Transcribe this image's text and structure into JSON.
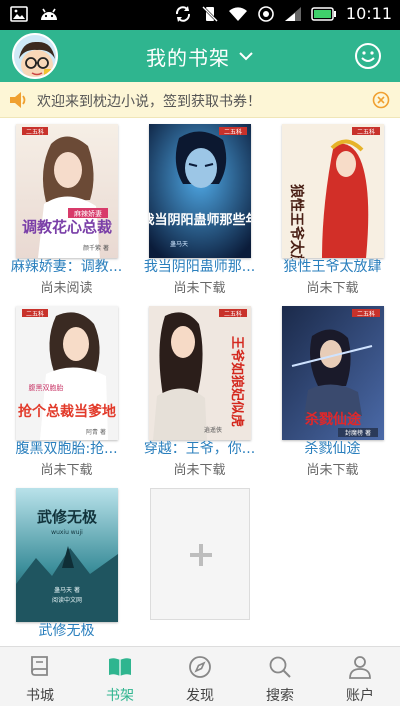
{
  "status_bar": {
    "time": "10:11"
  },
  "header": {
    "title": "我的书架"
  },
  "notice": {
    "text": "欢迎来到枕边小说，签到获取书券！"
  },
  "shelf": {
    "books": [
      {
        "title": "麻辣娇妻：调教...",
        "status": "尚未阅读",
        "cover_text": "调教花心总裁",
        "cover_sub": "麻辣娇妻",
        "cover_author": "颜千紫 著"
      },
      {
        "title": "我当阴阳蛊师那...",
        "status": "尚未下载",
        "cover_text": "我当阴阳蛊师那些年",
        "cover_author": "蛊马天"
      },
      {
        "title": "狼性王爷太放肆",
        "status": "尚未下载",
        "cover_text": "狼性王爷太放肆"
      },
      {
        "title": "腹黑双胞胎:抢...",
        "status": "尚未下载",
        "cover_text": "抢个总裁当爹地",
        "cover_sub": "腹黑双胞胎",
        "cover_author": "阿青 著"
      },
      {
        "title": "穿越：王爷，你...",
        "status": "尚未下载",
        "cover_text": "王爷如狼妃似虎",
        "cover_author": "逍遥侠"
      },
      {
        "title": "杀戮仙途",
        "status": "尚未下载",
        "cover_text": "杀戮仙途",
        "cover_sub": "封魔榜 著"
      },
      {
        "title": "武修无极",
        "status": "",
        "cover_text": "武修无极",
        "cover_sub": "wuxiu wuji",
        "cover_author": "蛊马天 著",
        "cover_publisher": "阅读中文网"
      }
    ],
    "publisher_badge": "二五科",
    "add_symbol": "+"
  },
  "bottom_nav": {
    "items": [
      {
        "label": "书城",
        "icon": "bookstore-icon",
        "active": false
      },
      {
        "label": "书架",
        "icon": "bookshelf-icon",
        "active": true
      },
      {
        "label": "发现",
        "icon": "compass-icon",
        "active": false
      },
      {
        "label": "搜索",
        "icon": "search-icon",
        "active": false
      },
      {
        "label": "账户",
        "icon": "account-icon",
        "active": false
      }
    ]
  },
  "colors": {
    "primary": "#2fb58f",
    "link": "#2a7fbd",
    "notice_bg": "#fdf6d6",
    "notice_icon": "#f0a030"
  }
}
